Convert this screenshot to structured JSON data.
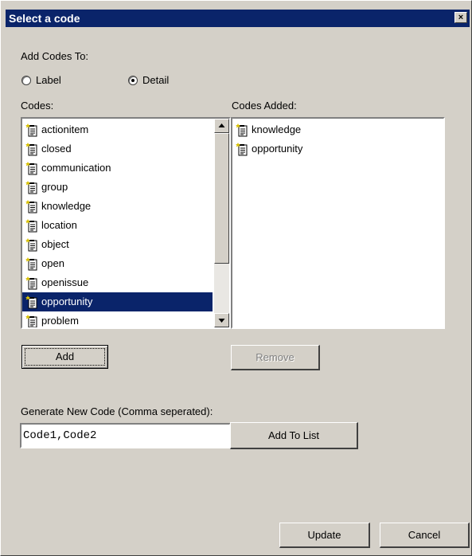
{
  "window": {
    "title": "Select a code",
    "close_glyph": "×"
  },
  "add_codes_to": {
    "label": "Add Codes To:",
    "options": [
      {
        "label": "Label",
        "checked": false
      },
      {
        "label": "Detail",
        "checked": true
      }
    ]
  },
  "codes": {
    "label": "Codes:",
    "items": [
      "actionitem",
      "closed",
      "communication",
      "group",
      "knowledge",
      "location",
      "object",
      "open",
      "openissue",
      "opportunity",
      "problem"
    ],
    "selected": "opportunity",
    "icon": "code-document-icon"
  },
  "codes_added": {
    "label": "Codes Added:",
    "items": [
      "knowledge",
      "opportunity"
    ],
    "icon": "code-document-icon"
  },
  "buttons": {
    "add": "Add",
    "remove": "Remove",
    "add_to_list": "Add To List",
    "update": "Update",
    "cancel": "Cancel"
  },
  "generate": {
    "label": "Generate New Code (Comma seperated):",
    "value": "Code1,Code2"
  },
  "colors": {
    "titlebar": "#0a246a",
    "selection": "#0a246a",
    "dialog_face": "#d4d0c8"
  }
}
